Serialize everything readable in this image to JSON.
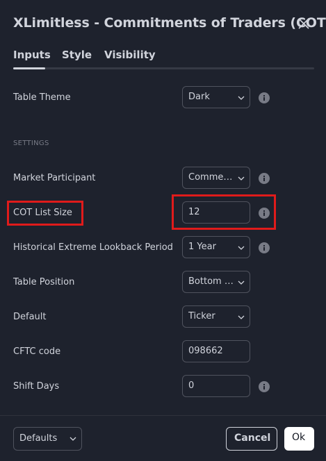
{
  "dialog": {
    "title": "XLimitless - Commitments of Traders (COT)"
  },
  "tabs": [
    {
      "label": "Inputs",
      "active": true
    },
    {
      "label": "Style",
      "active": false
    },
    {
      "label": "Visibility",
      "active": false
    }
  ],
  "fields": {
    "table_theme": {
      "label": "Table Theme",
      "value": "Dark",
      "type": "select"
    },
    "section_settings": "SETTINGS",
    "market_participant": {
      "label": "Market Participant",
      "value": "Commercials",
      "type": "select"
    },
    "cot_list_size": {
      "label": "COT List Size",
      "value": "12",
      "type": "input"
    },
    "historical_lookback": {
      "label": "Historical Extreme Lookback Period",
      "value": "1 Year",
      "type": "select"
    },
    "table_position": {
      "label": "Table Position",
      "value": "Bottom Right",
      "type": "select"
    },
    "default": {
      "label": "Default",
      "value": "Ticker",
      "type": "select"
    },
    "cftc_code": {
      "label": "CFTC code",
      "value": "098662",
      "type": "input"
    },
    "shift_days": {
      "label": "Shift Days",
      "value": "0",
      "type": "input"
    }
  },
  "footer": {
    "defaults_label": "Defaults",
    "cancel_label": "Cancel",
    "ok_label": "Ok"
  },
  "colors": {
    "background": "#1e222d",
    "text": "#d1d4dc",
    "muted": "#787b86",
    "border": "#50535e",
    "highlight": "#e01b1b"
  }
}
